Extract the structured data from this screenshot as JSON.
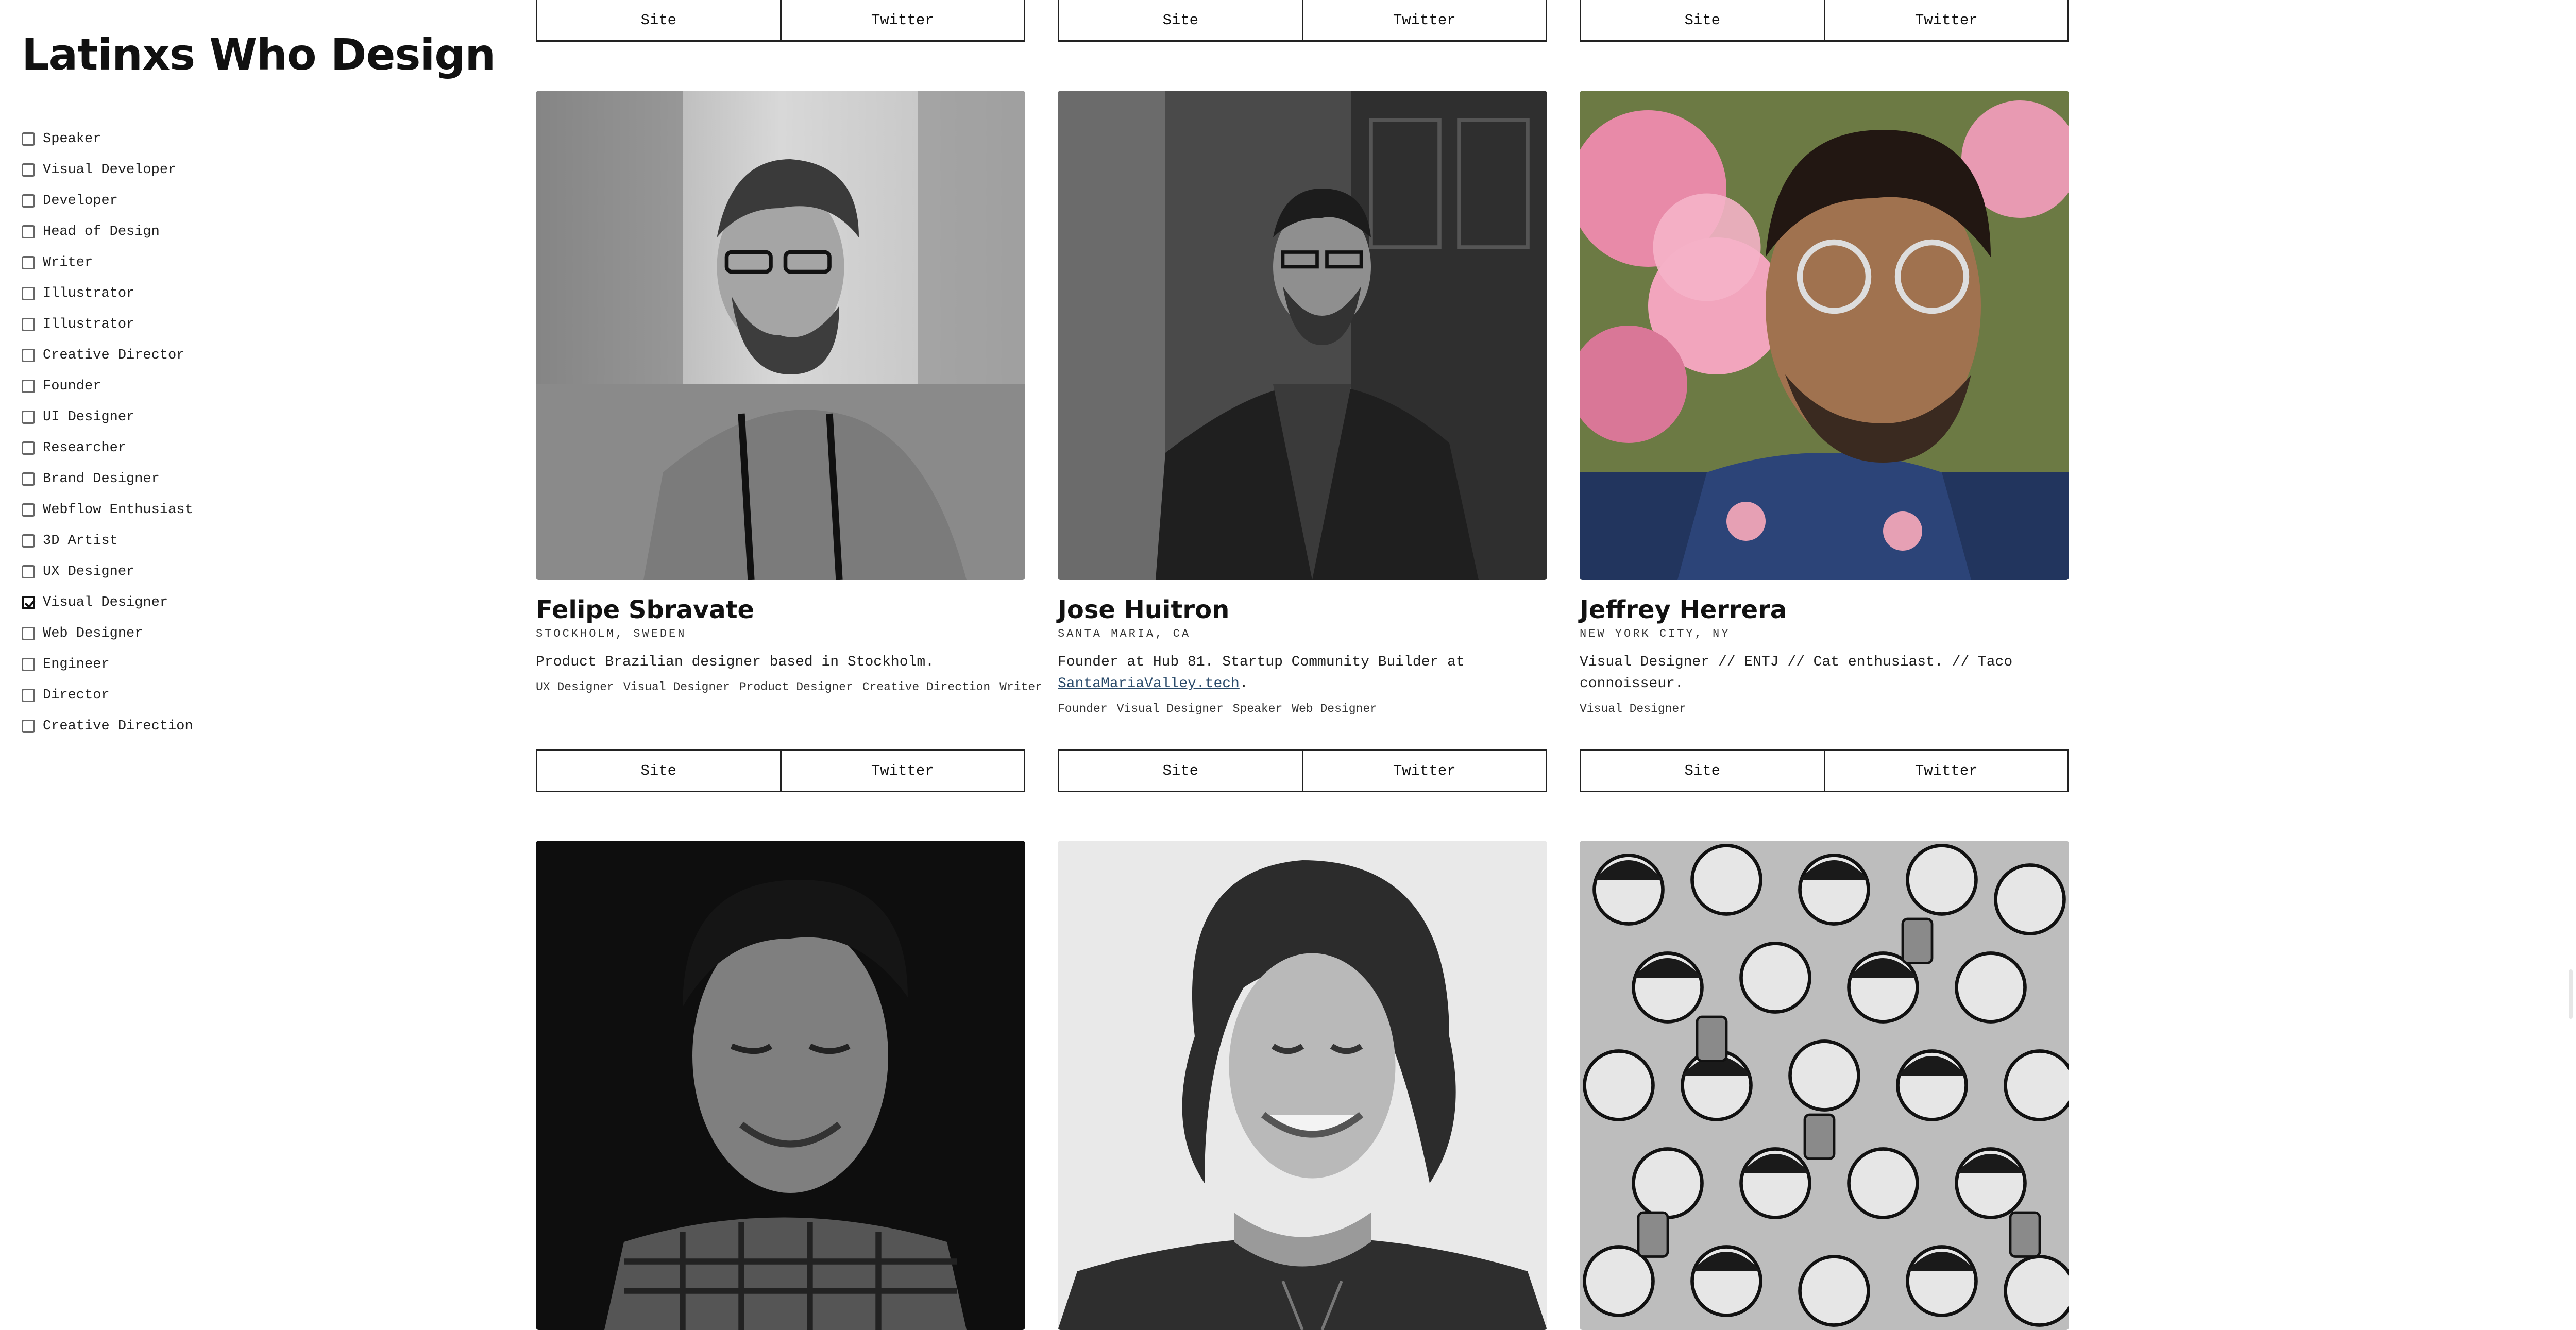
{
  "site": {
    "title": "Latinxs Who Design"
  },
  "filters": [
    {
      "label": "Speaker",
      "checked": false
    },
    {
      "label": "Visual Developer",
      "checked": false
    },
    {
      "label": "Developer",
      "checked": false
    },
    {
      "label": "Head of Design",
      "checked": false
    },
    {
      "label": "Writer",
      "checked": false
    },
    {
      "label": "Illustrator",
      "checked": false
    },
    {
      "label": "Illustrator",
      "checked": false
    },
    {
      "label": "Creative Director",
      "checked": false
    },
    {
      "label": "Founder",
      "checked": false
    },
    {
      "label": "UI Designer",
      "checked": false
    },
    {
      "label": "Researcher",
      "checked": false
    },
    {
      "label": "Brand Designer",
      "checked": false
    },
    {
      "label": "Webflow Enthusiast",
      "checked": false
    },
    {
      "label": "3D Artist",
      "checked": false
    },
    {
      "label": "UX Designer",
      "checked": false
    },
    {
      "label": "Visual Designer",
      "checked": true
    },
    {
      "label": "Web Designer",
      "checked": false
    },
    {
      "label": "Engineer",
      "checked": false
    },
    {
      "label": "Director",
      "checked": false
    },
    {
      "label": "Creative Direction",
      "checked": false
    }
  ],
  "buttons": {
    "site": "Site",
    "twitter": "Twitter"
  },
  "cards": [
    {
      "name": "Felipe Sbravate",
      "location": "Stockholm, Sweden",
      "bio": "Product Brazilian designer based in Stockholm.",
      "tags": [
        "UX Designer",
        "Visual Designer",
        "Product Designer",
        "Creative Direction",
        "Writer"
      ]
    },
    {
      "name": "Jose Huitron",
      "location": "Santa Maria, CA",
      "bio_text": "Founder at Hub 81. Startup Community Builder at",
      "bio_link": "SantaMariaValley.tech",
      "bio_after": ".",
      "tags": [
        "Founder",
        "Visual Designer",
        "Speaker",
        "Web Designer"
      ]
    },
    {
      "name": "Jeffrey Herrera",
      "location": "New York City, NY",
      "bio": "Visual Designer // ENTJ // Cat enthusiast. // Taco connoisseur.",
      "tags": [
        "Visual Designer"
      ]
    }
  ]
}
